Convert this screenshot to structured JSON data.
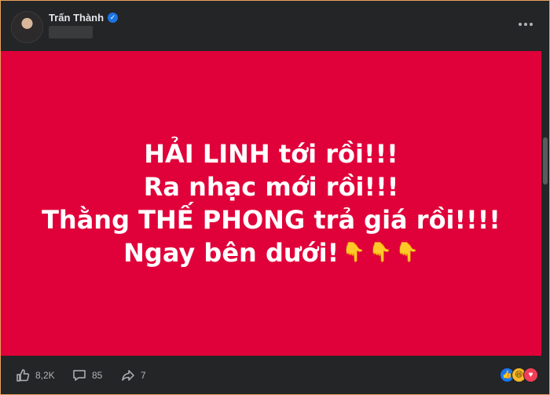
{
  "post": {
    "author": "Trấn Thành",
    "verified": true,
    "lines": [
      "HẢI LINH tới rồi!!!",
      "Ra nhạc mới rồi!!!",
      "Thằng THẾ PHONG trả giá rồi!!!!",
      "Ngay bên dưới!"
    ],
    "finger_emoji": "👇",
    "background_color": "#e0003a"
  },
  "footer": {
    "likes": "8,2K",
    "comments": "85",
    "shares": "7"
  },
  "reactions": [
    "like",
    "haha",
    "love"
  ]
}
